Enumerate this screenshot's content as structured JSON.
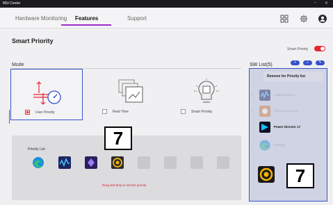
{
  "window": {
    "title": "MSI Center",
    "minimize_glyph": "–",
    "close_glyph": "✕"
  },
  "nav": {
    "tabs": [
      {
        "label": "Hardware Monitoring"
      },
      {
        "label": "Features"
      },
      {
        "label": "Support"
      }
    ],
    "active_tab": "Features",
    "icons": [
      "grid-icon",
      "gear-icon",
      "user-avatar-icon"
    ]
  },
  "page": {
    "title": "Smart Priority",
    "toggle_label": "Smart Priority",
    "toggle_on": true
  },
  "mode": {
    "label": "Mode",
    "options": [
      {
        "label": "User Priority",
        "checked": true
      },
      {
        "label": "Real-Time",
        "checked": false
      },
      {
        "label": "Smart Priority",
        "checked": false
      }
    ]
  },
  "priority_list": {
    "label": "Priority List",
    "apps": [
      "edge",
      "audio-director",
      "photo-director",
      "power-director",
      "empty",
      "empty",
      "empty",
      "empty"
    ],
    "hint": "Drag and drop to set the priority"
  },
  "overlay_numbers": {
    "left": "7",
    "right": "7"
  },
  "sw_list": {
    "title": "SW List(5)",
    "buttons": [
      "+",
      "⌕",
      "✎"
    ],
    "remove_label": "Remove for Priority list",
    "items": [
      {
        "name": "Audio Director 7",
        "faded": true
      },
      {
        "name": "Photo Director 10",
        "faded": true
      },
      {
        "name": "Power Director 17",
        "faded": false
      },
      {
        "name": "msedge",
        "faded": true
      }
    ]
  },
  "colors": {
    "accent": "#e82433",
    "select_blue": "#3552c9",
    "tab_underline": "#9a2bc6"
  }
}
